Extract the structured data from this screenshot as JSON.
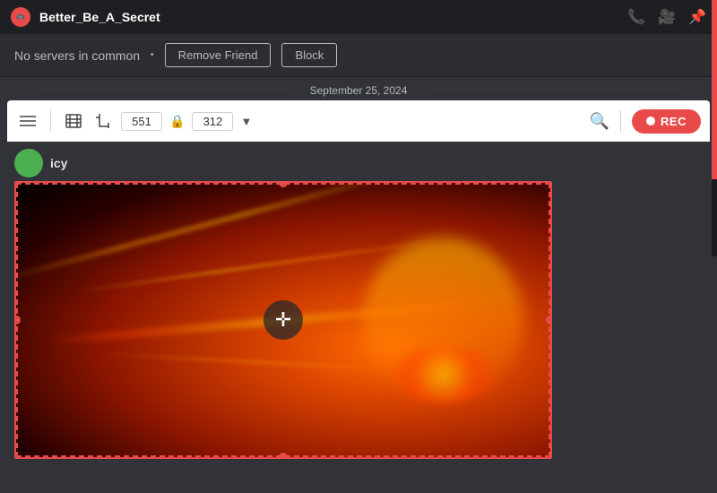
{
  "titleBar": {
    "username": "Better_Be_A_Secret",
    "avatarInitial": "🎮"
  },
  "subheader": {
    "noServersText": "No servers in common",
    "dotSeparator": "•",
    "removeFriendLabel": "Remove Friend",
    "blockLabel": "Block"
  },
  "dateSeparator": {
    "text": "September 25, 2024"
  },
  "toolbar": {
    "width": "551",
    "height": "312",
    "recLabel": "REC"
  },
  "messageArea": {
    "username": "icy"
  }
}
